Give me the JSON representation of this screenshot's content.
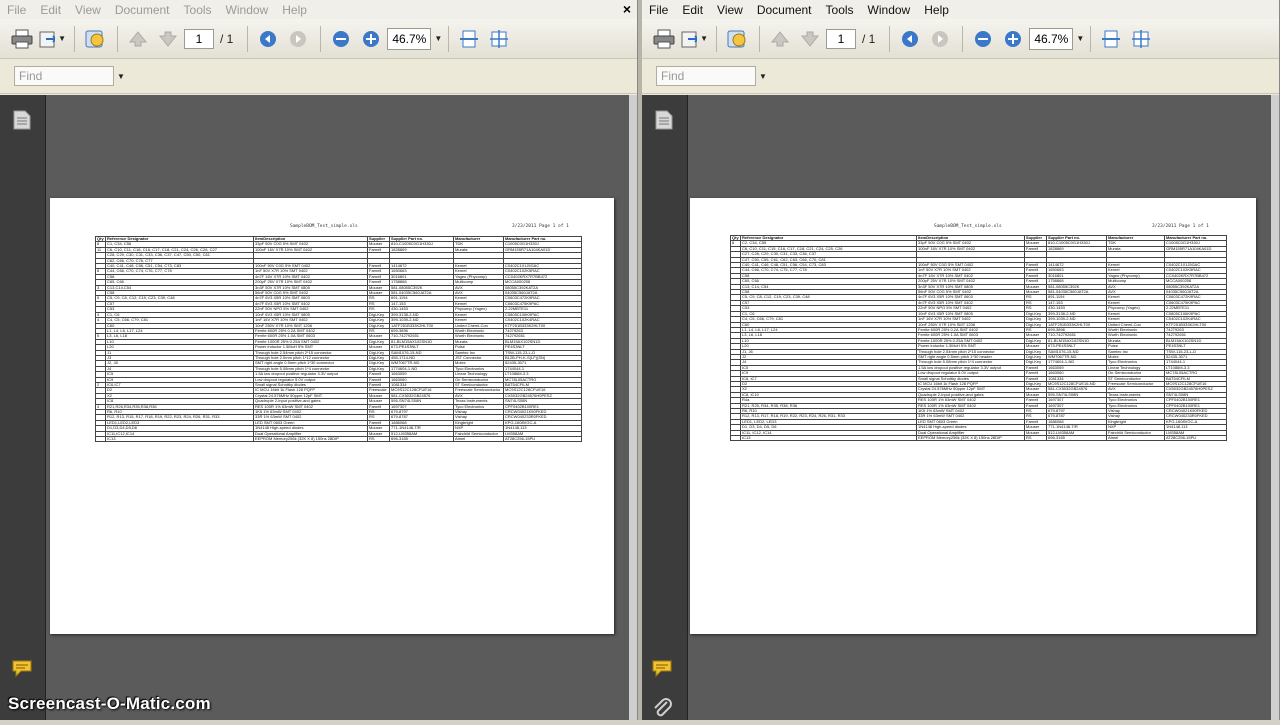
{
  "menu": [
    "File",
    "Edit",
    "View",
    "Document",
    "Tools",
    "Window",
    "Help"
  ],
  "close_glyph": "×",
  "toolbar": {
    "page_current": "1",
    "page_total": "/ 1",
    "zoom": "46.7%"
  },
  "find_placeholder": "Find",
  "icons": [
    "print-icon",
    "export-icon",
    "attach-icon",
    "prev-page-icon",
    "next-page-icon",
    "back-icon",
    "forward-icon",
    "zoom-out-icon",
    "zoom-in-icon",
    "fit-width-icon",
    "fit-page-icon",
    "pages-panel-icon",
    "comments-icon",
    "attachment-icon"
  ],
  "left_doc": {
    "header_title": "SampleBOM_Test_simple.xls",
    "header_date": "3/23/2011  Page 1 of 1",
    "columns": [
      "Qty",
      "Reference  Designator",
      "ItemDescription",
      "Supplier",
      "Supplier Part no.",
      "Manufacturer",
      "Manufacturer Part no."
    ],
    "rows": [
      [
        "8",
        "C1, C34, C56",
        "33pF 50V C0G 5% SMT 0402",
        "Mouser",
        "810-C1005C0G1H330J",
        "TDK",
        "C1005C0G1H330J"
      ],
      [
        "11",
        "C6, C10, C11, C18, C16, C17, C18, C21, C24, C26, C26, C27",
        "100nF 16V X7R 10% SMT 0402",
        "Farnell",
        "1828869",
        "Murata",
        "GRM155R71A104KA01D"
      ],
      [
        "",
        "C28, C29, C30, C31, C33, C36, C37, C47, C50, C50, C61",
        "",
        "",
        "",
        "",
        ""
      ],
      [
        "",
        "C62, C66, C70, C76, C77",
        "",
        "",
        "",
        "",
        ""
      ],
      [
        "",
        "C40, C41, C48, C56, C51, C54, C73, C83",
        "100nF 50V C0G 5% SMT 0402",
        "Farnell",
        "1414672",
        "Kemet",
        "C0402C101J5GAC"
      ],
      [
        "8",
        "C44, C66, C70, C74, C76, C77, C78",
        "1nF 50V X7R 10% SMT 0402",
        "Farnell",
        "1650663",
        "Kemet",
        "C0402C102K5RAC"
      ],
      [
        "",
        "C58",
        "4n7F 16V X7R 10% SMT 0402",
        "Farnell",
        "3016801",
        "Yageo (Phycomp)",
        "CC0402KRX7R7BB472"
      ],
      [
        "",
        "C65, C66",
        "200pF 25V X7R 10% SMT 0402",
        "Farnell",
        "1758868",
        "Multicomp",
        "MCCA000258"
      ],
      [
        "3",
        "C13,C14,C54",
        "3n3F 50V X7R 10% SMT 0805",
        "Mouser",
        "581-08055C392K",
        "AVX",
        "08055C392KAT2A"
      ],
      [
        "",
        "C58",
        "56nF 50V C0G 5% SMT 0402",
        "Mouser",
        "581-04035C560JAT2A",
        "AVX",
        "04035C560JAT2A"
      ],
      [
        "5",
        "C5, C9, C8, C12, C19, C23, C39, C48",
        "4n7F 6V3 X5R 10% SMT 0603",
        "RS",
        "691-1194",
        "Kemet",
        "C0603C472K9RAC"
      ],
      [
        "",
        "C57",
        "4n7F 6V3 X5R 10% SMT 0402",
        "RS",
        "147-153",
        "Kemet",
        "C0603C475K9PAC"
      ],
      [
        "",
        "C53",
        "22nF 50V NPO 5% SMT 0402",
        "RS",
        "430-1453",
        "Phycomp (Yageo)",
        "2.22MBTE11"
      ],
      [
        "4",
        "C1, C6",
        "10nF 6V3 X5R 10% SMT 0805",
        "Digi-Key",
        "399-3138-2-ND",
        "Kemet",
        "C0805C106K9PAC"
      ],
      [
        "4",
        "C4, C5, C66, C79, C81",
        "1nF 16V X7R 10% SMT 0402",
        "Digi-Key",
        "399-1039-2-ND",
        "Kemet",
        "C0402C102K4RAC"
      ],
      [
        "",
        "C60",
        "10nF 250V X7R 10% SMT 1206",
        "Digi-Key",
        "1ATF251B333K2HLT00",
        "United Chemi-Con",
        "KTF251B333K2HLT00"
      ],
      [
        "",
        "L1, L4, L6, L17, L24",
        "Ferrite 600R 25% 0.2A SMT 0402",
        "RS",
        "699-3896",
        "Wurth Electronic",
        "74279263"
      ],
      [
        "5",
        "L3, L6, L18",
        "Ferrite 600R 25% 1.0A SMT 0603",
        "Mouser",
        "710-742792651",
        "Wurth Electronic",
        "742792651"
      ],
      [
        "",
        "L10",
        "Ferrite 1000R 25% 0.25A SMT 0402",
        "Digi-Key",
        "81-BLM15AX102SN1D",
        "Murata",
        "BLM15AX102SN1D"
      ],
      [
        "",
        "L20",
        "Power inductor 1.5MuH 5% SMT",
        "Mouser",
        "673-PE4S3NLT",
        "Pulse",
        "PE4S3NLT"
      ],
      [
        "",
        "J1",
        "Through hole 2.54mm pitch 2*15 connector",
        "Digi-Key",
        "SAM1076-15-ND",
        "Samtec Inc",
        "TSW-115-23-L-D"
      ],
      [
        "",
        "J3",
        "Through hole 2.0mm pitch 1*12 connector",
        "Digi-Key",
        "455-1714-ND",
        "JST Connector",
        "B12B-PH-K-S(LF)(SN)"
      ],
      [
        "",
        "J2, J8",
        "SMT right angle 0.5mm pitch 1*30 connector",
        "Digi-Key",
        "WM7067TR-ND",
        "Molex",
        "52435-3071"
      ],
      [
        "",
        "J4",
        "Through hole 5.08mm pitch 1*4 connector",
        "Digi-Key",
        "1774604-1-ND",
        "Tyco Electronics",
        "1744044-1"
      ],
      [
        "",
        "IC5",
        "1.5A low dropout positive regulator 3.3V output",
        "Farnell",
        "1663059",
        "Linear Technology",
        "LT1086M-3.3"
      ],
      [
        "",
        "IC9",
        "Low dropout regulator 5.0V output",
        "Farnell",
        "1663060",
        "On Semiconductor",
        "MC78L05ACTRG"
      ],
      [
        "2",
        "IC6,IC7",
        "Small signal Schottky diodes",
        "Farnell",
        "1081334",
        "ST Semiconductor",
        "BAT54CFILM"
      ],
      [
        "",
        "D2",
        "IC MCU 16bit 1k Flash 128 PQFP",
        "Freescale",
        "MC9S12C128CFUE16",
        "Freescale Semiconductor",
        "MC9S12C128CFUE16"
      ],
      [
        "",
        "X2",
        "Crystal 24.576MHz 50ppm 12pF SMT",
        "Mouser",
        "581-CX5032GB24576",
        "AVX",
        "CX5032GB24576H0PESZ"
      ],
      [
        "",
        "IC8",
        "Quadruple 2-input positive-and gates",
        "Mouser",
        "595-SN74LS08N",
        "Texas Instruments",
        "SN74LS08N"
      ],
      [
        "4",
        "R21,R26,R34,R35,R38,R36",
        "RES 100R 1% 63mW SMT 0402",
        "Farnell",
        "1697307",
        "Tyco Electronics",
        "CPF0402B100RE1"
      ],
      [
        "",
        "R6, R10",
        "1K5 1% 63mW SMT 0402",
        "RS",
        "679-8797",
        "Vishay",
        "CRCW04021K50FKED"
      ],
      [
        "",
        "R12, R13, R15, R17, R18, R19, R22, R23, R24, R26, R31, R33",
        "33R 1% 63mW SMT 0402",
        "RS",
        "679-8787",
        "Vishay",
        "CRCW040233R0FKED"
      ],
      [
        "",
        "LED1,LED2,LED3",
        "LED SMT 0603 Green",
        "Farnell",
        "1686068",
        "Kingbright",
        "KPG-1608VGC-A"
      ],
      [
        "",
        "D1,D3,D4,D5,D6",
        "1N4148 High-speed diodes",
        "Mouser",
        "771-1N4148-T/R",
        "NXP",
        "1N4148,113"
      ],
      [
        "",
        "IC11,IC12,IC14",
        "Dual Operational Amplifier",
        "Mouser",
        "512-LM358AM",
        "Fairchild Semiconductor",
        "LM358AM"
      ],
      [
        "",
        "IC13",
        "EEPROM Memory256k (32K X 8) 150ns 28DIP",
        "RS",
        "696-3165",
        "Atmel",
        "AT28C256-15PU"
      ]
    ]
  },
  "right_doc": {
    "header_title": "SampleBOM_Test_simple.xls",
    "header_date": "3/23/2011  Page 1 of 1",
    "columns": [
      "Qty",
      "Reference  Designator",
      "ItemDescription",
      "Supplier",
      "Supplier Part no.",
      "Manufacturer",
      "Manufacturer Part no."
    ],
    "rows": [
      [
        "8",
        "C2, C34, C55",
        "33pF 50V C0G 5% SMT 0402",
        "Mouser",
        "810-C1005C0G1H330J",
        "TDK",
        "C1005C0G1H330J"
      ],
      [
        "",
        "C6, C10, C11, C15, C16, C17, C18, C21, C24, C25, C26",
        "100nF 16V X7R 10% SMT 0402",
        "Farnell",
        "1828869",
        "Murata",
        "GRM155R71A104KA01D"
      ],
      [
        "",
        "C27, C28, C29, C30, C31, C33, C36, C37",
        "",
        "",
        "",
        "",
        ""
      ],
      [
        "",
        "C47, C50, C55, C61, C62, C63, C66, C70, C81",
        "",
        "",
        "",
        "",
        ""
      ],
      [
        "",
        "C40, C41, C46, C48, C51, C56, C54, C73, C83",
        "100nF 50V C0G 5% SMT 0402",
        "Farnell",
        "1414672",
        "Kemet",
        "C0402C101J5GAC"
      ],
      [
        "",
        "C44, C66, C70, C74, C75, C77, C78",
        "1nF 50V X7R 10% SMT 0402",
        "Farnell",
        "1650663",
        "Kemet",
        "C0402C102K5RAC"
      ],
      [
        "",
        "C58",
        "4n7F 16V X7R 10% SMT 0402",
        "Farnell",
        "3016801",
        "Yageo (Phycomp)",
        "CC0402KRX7R7BB472"
      ],
      [
        "",
        "C65, C66",
        "200pF 25V X7R 10% SMT 0402",
        "Farnell",
        "1758868",
        "Multicomp",
        "MCCA000258"
      ],
      [
        "",
        "C13, C14, C54",
        "3n3F 50V X7R 10% SMT 0805",
        "Mouser",
        "581-08055C392K",
        "AVX",
        "08055C392KAT2A"
      ],
      [
        "",
        "C58",
        "56nF 50V C0G 5% SMT 0402",
        "Mouser",
        "581-04035C560JAT2A",
        "AVX",
        "04035C560JAT2A"
      ],
      [
        "",
        "C5, C9, C8, C12, C19, C23, C39, C48",
        "4n7F 6V3 X5R 10% SMT 0603",
        "RS",
        "691-1194",
        "Kemet",
        "C0603C472K9RAC"
      ],
      [
        "",
        "C57",
        "4n7F 6V3 X5R 10% SMT 0402",
        "RS",
        "147-153",
        "Kemet",
        "C0603C475K9PAC"
      ],
      [
        "",
        "C53",
        "22nF 50V NPO 5% SMT 0402",
        "RS",
        "430-1453",
        "Phycomp (Yageo)",
        "2.22MBTE11"
      ],
      [
        "",
        "C1, C6",
        "10nF 6V3 X5R 10% SMT 0805",
        "Digi-Key",
        "399-3138-2-ND",
        "Kemet",
        "C0805C106K9PAC"
      ],
      [
        "",
        "C4, C5, C66, C79, C81",
        "1nF 16V X7R 10% SMT 0402",
        "Digi-Key",
        "399-1039-2-ND",
        "Kemet",
        "C0402C102K4RAC"
      ],
      [
        "",
        "C60",
        "10nF 250V X7R 10% SMT 1206",
        "Digi-Key",
        "1ATF251B333K2HLT00",
        "United Chemi-Con",
        "KTF251B333K2HLT00"
      ],
      [
        "",
        "L1, L4, L6, L17, L24",
        "Ferrite 600R 25% 0.2A SMT 0402",
        "RS",
        "699-3896",
        "Wurth Electronic",
        "74279263"
      ],
      [
        "",
        "L3, L6, L18",
        "Ferrite 600R 25% 1.0A SMT 0603",
        "Mouser",
        "710-742792651",
        "Wurth Electronic",
        "742792651"
      ],
      [
        "",
        "L10",
        "Ferrite 1000R 25% 0.25A SMT 0402",
        "Digi-Key",
        "81-BLM15AX102SN1D",
        "Murata",
        "BLM15AX102SN1D"
      ],
      [
        "",
        "L20",
        "Power inductor 1.5MuH 5% SMT",
        "Mouser",
        "673-PE4S3NLT",
        "Pulse",
        "PE4S3NLT"
      ],
      [
        "",
        "J1, J6",
        "Through hole 2.54mm pitch 2*15 connector",
        "Digi-Key",
        "SAM1076-15-ND",
        "Samtec Inc",
        "TSW-115-23-L-D"
      ],
      [
        "",
        "J2",
        "SMT right angle 0.5mm pitch 1*30 header",
        "Digi-Key",
        "WM7067TR-ND",
        "Molex",
        "52435-3071"
      ],
      [
        "",
        "J4",
        "Through hole 5.08mm pitch 1*4 connector",
        "Digi-Key",
        "1774604-1-ND",
        "Tyco Electronics",
        "1744044-1"
      ],
      [
        "",
        "IC5",
        "1.5A low dropout positive regulator 3.3V output",
        "Farnell",
        "1663059",
        "Linear Technology",
        "LT1086M-3.3"
      ],
      [
        "",
        "IC9",
        "Low dropout regulator 5.0V output",
        "Farnell",
        "1663060",
        "On Semiconductor",
        "MC78L05ACTRG"
      ],
      [
        "",
        "IC6, IC7",
        "Small signal Schottky diodes",
        "Farnell",
        "1081334",
        "ST Semiconductor",
        "BAT54CFILM"
      ],
      [
        "",
        "D2",
        "IC MCU 16bit 1k Flash 128 PQFP",
        "Digi-Key",
        "MC9S12C128CFUE16-ND",
        "Freescale Semiconductor",
        "MC9S12C128CFUE16"
      ],
      [
        "",
        "X2",
        "Crystal 24.576MHz 50ppm 12pF SMT",
        "Mouser",
        "581-CX5032GB24576",
        "AVX",
        "CX5032GB24576H0PESZ"
      ],
      [
        "",
        "IC8, IC10",
        "Quadruple 2-input positive-and gates",
        "Mouser",
        "595-SN74LS08N",
        "Texas Instruments",
        "SN74LS08N"
      ],
      [
        "",
        "R4a",
        "RES 100R 1% 63mW SMT 0402",
        "Farnell",
        "1697307",
        "Tyco Electronics",
        "CPF0402B100RE1"
      ],
      [
        "",
        "R21, R25, R34, R35, R38, R36",
        "RES 100R 1% 63mW SMT 0402",
        "Farnell",
        "1697307",
        "Tyco Electronics",
        "CPF0402B100RE1"
      ],
      [
        "",
        "R6, R10",
        "1K5 1% 63mW SMT 0402",
        "RS",
        "679-8797",
        "Vishay",
        "CRCW04021K50FKED"
      ],
      [
        "",
        "R12, R13, R17, R18, R19, R22, R23, R24, R26, R31, R33",
        "33R 1% 63mW SMT 0402",
        "RS",
        "679-8787",
        "Vishay",
        "CRCW040233R0FKED"
      ],
      [
        "",
        "LED1, LED2, LED3",
        "LED SMT 0603 Green",
        "Farnell",
        "1686068",
        "Kingbright",
        "KPG-1608VGC-A"
      ],
      [
        "",
        "D1, D3, D4, D5, D6",
        "1N4148 High-speed diodes",
        "Mouser",
        "771-1N4148-T/R",
        "NXP",
        "1N4148,113"
      ],
      [
        "",
        "IC11, IC12, IC14",
        "Dual Operational Amplifier",
        "Mouser",
        "512-LM358AM",
        "Fairchild Semiconductor",
        "LM358AM"
      ],
      [
        "",
        "IC13",
        "EEPROM Memory256k (32K X 8) 150ns 28DIP",
        "RS",
        "696-3165",
        "Atmel",
        "AT28C256-15PU"
      ]
    ]
  },
  "watermark": "Screencast-O-Matic.com"
}
